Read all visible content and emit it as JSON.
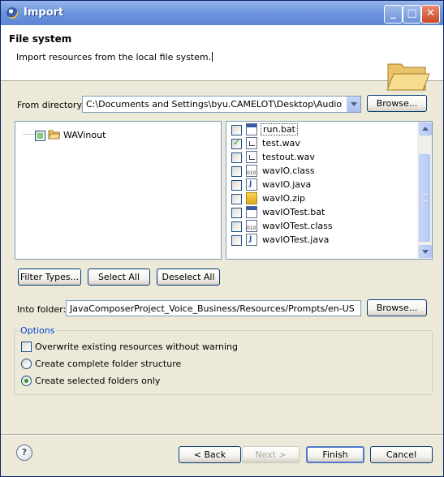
{
  "window": {
    "title": "Import",
    "controls": {
      "minimize": "_",
      "maximize": "□",
      "close": "✕"
    }
  },
  "header": {
    "title": "File system",
    "description": "Import resources from the local file system."
  },
  "from_directory": {
    "label": "From directory:",
    "value": "C:\\Documents and Settings\\byu.CAMELOT\\Desktop\\Audio Things\\",
    "browse_label": "Browse..."
  },
  "tree": {
    "items": [
      {
        "label": "WAVinout",
        "state": "partial"
      }
    ]
  },
  "files": [
    {
      "name": "run.bat",
      "icon": "bat-file-icon",
      "checked": false
    },
    {
      "name": "test.wav",
      "icon": "wav-file-icon",
      "checked": true
    },
    {
      "name": "testout.wav",
      "icon": "wav-file-icon",
      "checked": false
    },
    {
      "name": "wavIO.class",
      "icon": "class-file-icon",
      "checked": false
    },
    {
      "name": "wavIO.java",
      "icon": "java-file-icon",
      "checked": false
    },
    {
      "name": "wavIO.zip",
      "icon": "zip-file-icon",
      "checked": false
    },
    {
      "name": "wavIOTest.bat",
      "icon": "bat-file-icon",
      "checked": false
    },
    {
      "name": "wavIOTest.class",
      "icon": "class-file-icon",
      "checked": false
    },
    {
      "name": "wavIOTest.java",
      "icon": "java-file-icon",
      "checked": false
    }
  ],
  "selection_buttons": {
    "filter_types": "Filter Types...",
    "select_all": "Select All",
    "deselect_all": "Deselect All"
  },
  "into_folder": {
    "label": "Into folder:",
    "value": "JavaComposerProject_Voice_Business/Resources/Prompts/en-US",
    "browse_label": "Browse..."
  },
  "options": {
    "group_label": "Options",
    "overwrite": {
      "label": "Overwrite existing resources without warning",
      "checked": false
    },
    "create_complete": {
      "label": "Create complete folder structure",
      "selected": false
    },
    "create_selected": {
      "label": "Create selected folders only",
      "selected": true
    }
  },
  "footer": {
    "help": "?",
    "back": "< Back",
    "next": "Next >",
    "finish": "Finish",
    "cancel": "Cancel"
  },
  "colors": {
    "title_bar": "#6f96dd",
    "dialog_bg": "#ece9d8",
    "group_label": "#0046d5",
    "check": "#21a121"
  }
}
